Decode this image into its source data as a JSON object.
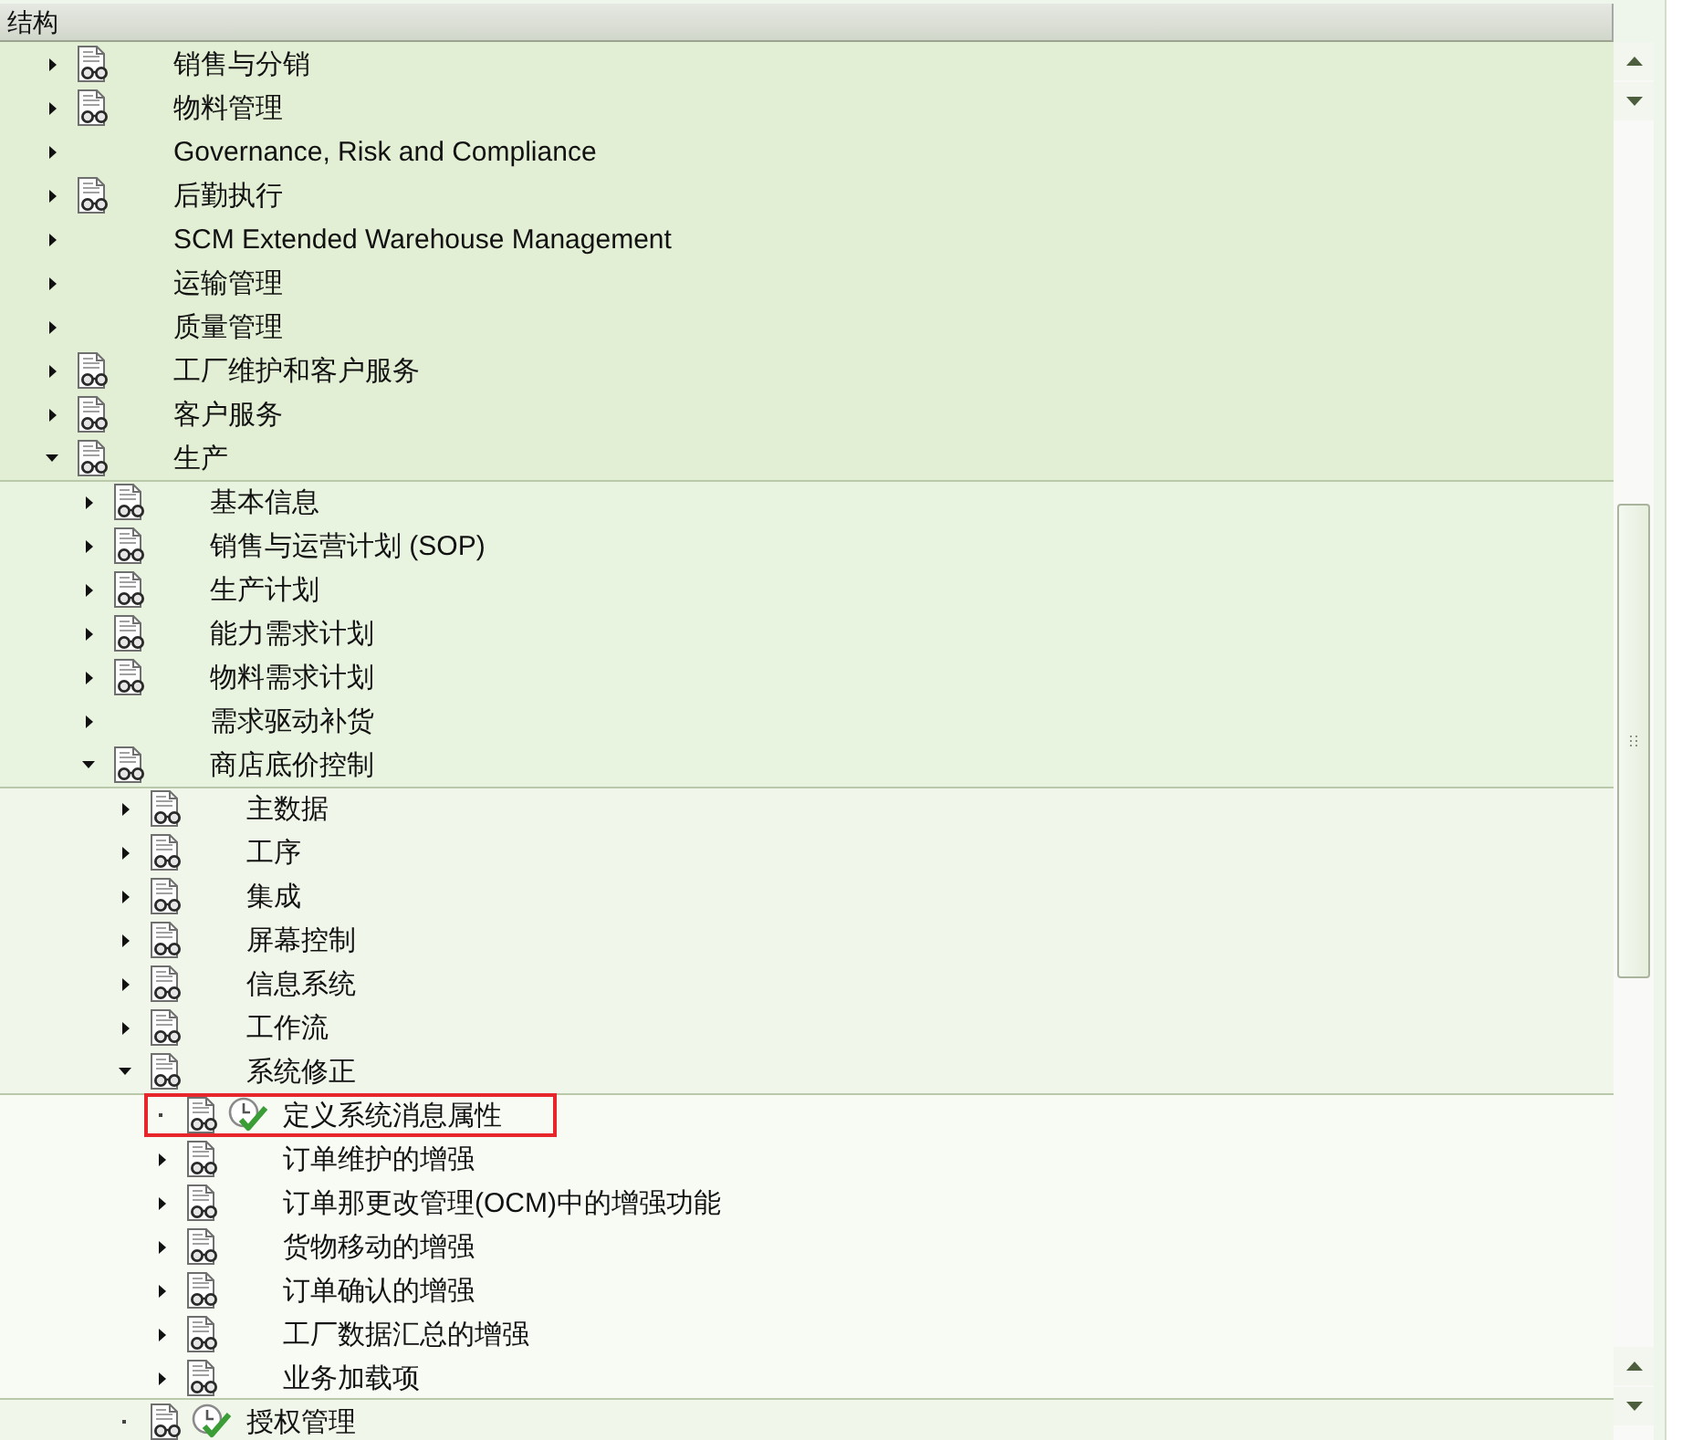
{
  "panel": {
    "header": "结构"
  },
  "tree": [
    {
      "label": "销售与分销",
      "kind": "folder",
      "expanded": false,
      "documentation": true,
      "activity": false
    },
    {
      "label": "物料管理",
      "kind": "folder",
      "expanded": false,
      "documentation": true,
      "activity": false
    },
    {
      "label": "Governance, Risk and Compliance",
      "kind": "folder",
      "expanded": false,
      "documentation": false,
      "activity": false
    },
    {
      "label": "后勤执行",
      "kind": "folder",
      "expanded": false,
      "documentation": true,
      "activity": false
    },
    {
      "label": "SCM Extended Warehouse Management",
      "kind": "folder",
      "expanded": false,
      "documentation": false,
      "activity": false
    },
    {
      "label": "运输管理",
      "kind": "folder",
      "expanded": false,
      "documentation": false,
      "activity": false
    },
    {
      "label": "质量管理",
      "kind": "folder",
      "expanded": false,
      "documentation": false,
      "activity": false
    },
    {
      "label": "工厂维护和客户服务",
      "kind": "folder",
      "expanded": false,
      "documentation": true,
      "activity": false
    },
    {
      "label": "客户服务",
      "kind": "folder",
      "expanded": false,
      "documentation": true,
      "activity": false
    },
    {
      "label": "生产",
      "kind": "folder",
      "expanded": true,
      "documentation": true,
      "activity": false,
      "children": [
        {
          "label": "基本信息",
          "kind": "folder",
          "expanded": false,
          "documentation": true,
          "activity": false
        },
        {
          "label": "销售与运营计划 (SOP)",
          "kind": "folder",
          "expanded": false,
          "documentation": true,
          "activity": false
        },
        {
          "label": "生产计划",
          "kind": "folder",
          "expanded": false,
          "documentation": true,
          "activity": false
        },
        {
          "label": "能力需求计划",
          "kind": "folder",
          "expanded": false,
          "documentation": true,
          "activity": false
        },
        {
          "label": "物料需求计划",
          "kind": "folder",
          "expanded": false,
          "documentation": true,
          "activity": false
        },
        {
          "label": "需求驱动补货",
          "kind": "folder",
          "expanded": false,
          "documentation": false,
          "activity": false
        },
        {
          "label": "商店底价控制",
          "kind": "folder",
          "expanded": true,
          "documentation": true,
          "activity": false,
          "children": [
            {
              "label": "主数据",
              "kind": "folder",
              "expanded": false,
              "documentation": true,
              "activity": false
            },
            {
              "label": "工序",
              "kind": "folder",
              "expanded": false,
              "documentation": true,
              "activity": false
            },
            {
              "label": "集成",
              "kind": "folder",
              "expanded": false,
              "documentation": true,
              "activity": false
            },
            {
              "label": "屏幕控制",
              "kind": "folder",
              "expanded": false,
              "documentation": true,
              "activity": false
            },
            {
              "label": "信息系统",
              "kind": "folder",
              "expanded": false,
              "documentation": true,
              "activity": false
            },
            {
              "label": "工作流",
              "kind": "folder",
              "expanded": false,
              "documentation": true,
              "activity": false
            },
            {
              "label": "系统修正",
              "kind": "folder",
              "expanded": true,
              "documentation": true,
              "activity": false,
              "children": [
                {
                  "label": "定义系统消息属性",
                  "kind": "leaf",
                  "documentation": true,
                  "activity": true,
                  "highlighted": true
                },
                {
                  "label": "订单维护的增强",
                  "kind": "folder",
                  "expanded": false,
                  "documentation": true,
                  "activity": false,
                  "highlighted": false
                },
                {
                  "label": "订单那更改管理(OCM)中的增强功能",
                  "kind": "folder",
                  "expanded": false,
                  "documentation": true,
                  "activity": false,
                  "highlighted": false
                },
                {
                  "label": "货物移动的增强",
                  "kind": "folder",
                  "expanded": false,
                  "documentation": true,
                  "activity": false,
                  "highlighted": false
                },
                {
                  "label": "订单确认的增强",
                  "kind": "folder",
                  "expanded": false,
                  "documentation": true,
                  "activity": false,
                  "highlighted": false
                },
                {
                  "label": "工厂数据汇总的增强",
                  "kind": "folder",
                  "expanded": false,
                  "documentation": true,
                  "activity": false,
                  "highlighted": false
                },
                {
                  "label": "业务加载项",
                  "kind": "folder",
                  "expanded": false,
                  "documentation": true,
                  "activity": false,
                  "highlighted": false
                }
              ]
            },
            {
              "label": "授权管理",
              "kind": "leaf",
              "documentation": true,
              "activity": true
            }
          ]
        }
      ]
    }
  ]
}
